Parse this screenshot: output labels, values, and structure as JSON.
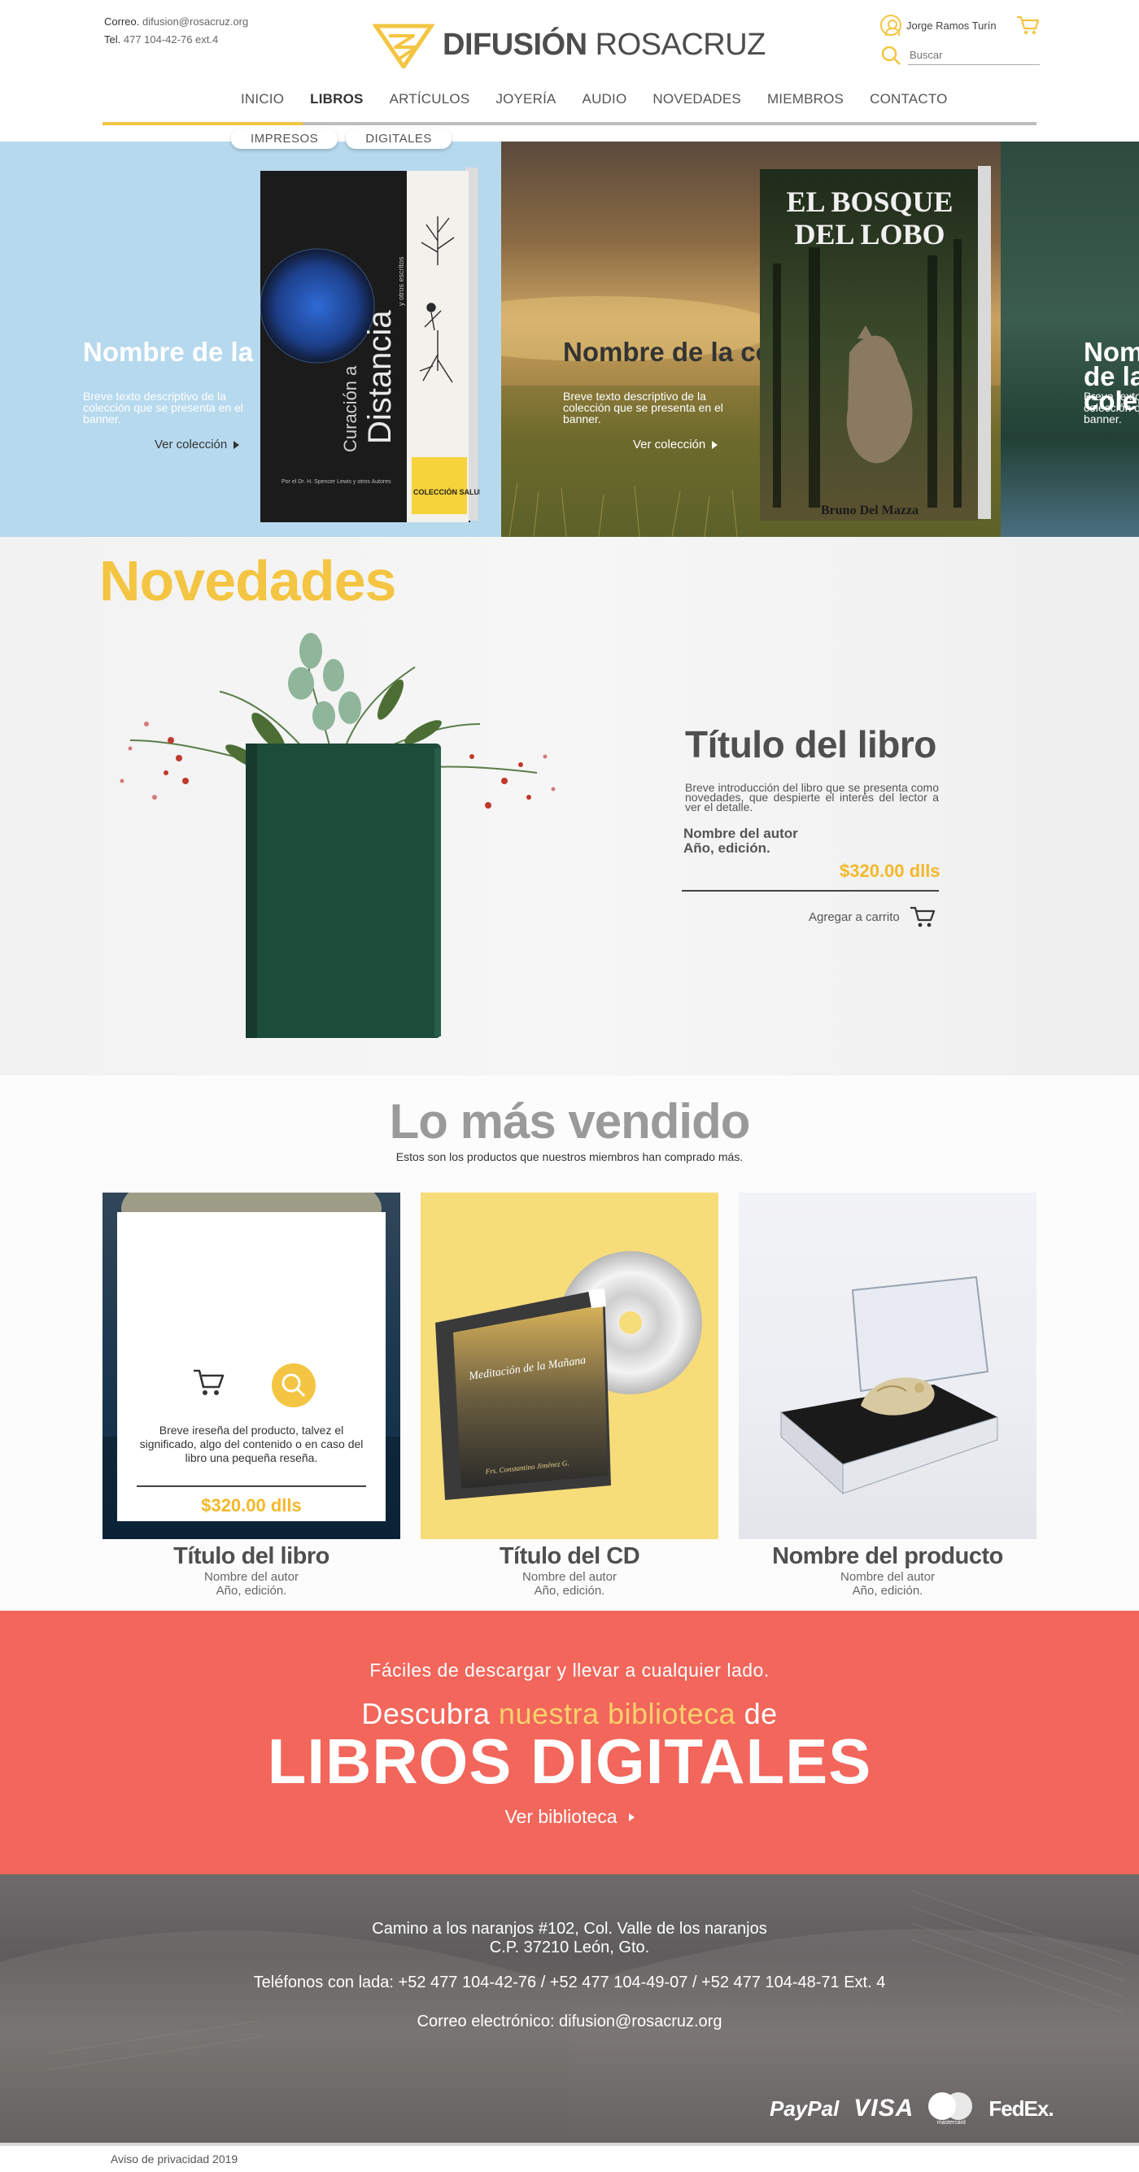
{
  "header": {
    "contact": {
      "email_label": "Correo.",
      "email": "difusion@rosacruz.org",
      "phone_label": "Tel.",
      "phone": "477 104-42-76  ext.4"
    },
    "logo": {
      "bold": "DIFUSIÓN",
      "regular": "ROSACRUZ"
    },
    "user_name": "Jorge Ramos Turín",
    "search_placeholder": "Buscar",
    "nav": [
      "INICIO",
      "LIBROS",
      "ARTÍCULOS",
      "JOYERÍA",
      "AUDIO",
      "NOVEDADES",
      "MIEMBROS",
      "CONTACTO"
    ],
    "active_nav": "LIBROS",
    "subnav": [
      "IMPRESOS",
      "DIGITALES"
    ]
  },
  "banner": {
    "slides": [
      {
        "title": "Nombre de la colección.",
        "desc": "Breve texto descriptivo de la colección que se presenta en el banner.",
        "link": "Ver colección",
        "book": {
          "title_small": "Curación a",
          "title_big": "Distancia",
          "title_sub": "y otros escritos",
          "author": "Por el Dr. H. Spencer Lewis y otros Autores",
          "series": "COLECCIÓN SALUD"
        }
      },
      {
        "title": "Nombre de la colección.",
        "desc": "Breve texto descriptivo de la colección que se presenta en el banner.",
        "link": "Ver colección",
        "book": {
          "title_line1": "EL BOSQUE",
          "title_line2": "DEL LOBO",
          "author": "Bruno Del Mazza"
        }
      },
      {
        "title": "Nombre de la colección.",
        "desc": "Breve texto descriptivo de la colección que se presenta en el banner."
      }
    ]
  },
  "novedades": {
    "heading": "Novedades",
    "book_title": "Título del libro",
    "desc": "Breve introducción del libro que se presenta como novedades, que despierte el interés del lector a ver el detalle.",
    "author": "Nombre del autor",
    "year": "Año, edición.",
    "price": "$320.00 dlls",
    "cart_label": "Agregar a carrito"
  },
  "bestsellers": {
    "heading": "Lo más vendido",
    "subheading": "Estos son los productos que nuestros miembros han comprado más.",
    "items": [
      {
        "title": "Título del libro",
        "author": "Nombre del autor",
        "year": "Año, edición.",
        "overlay_desc": "Breve ireseña del producto, talvez el significado, algo del contenido o en caso del libro una pequeña reseña.",
        "overlay_price": "$320.00 dlls"
      },
      {
        "title": "Título del CD",
        "author": "Nombre del autor",
        "year": "Año, edición.",
        "cd_cover_text": "Meditación de la Mañana",
        "cd_cover_sub": "Frs. Constantino Jiménez G."
      },
      {
        "title": "Nombre del producto",
        "author": "Nombre del autor",
        "year": "Año, edición."
      }
    ]
  },
  "digital": {
    "tagline": "Fáciles de descargar y llevar a cualquier lado.",
    "line_pre": "Descubra",
    "line_highlight": "nuestra biblioteca",
    "line_post": "de",
    "big": "LIBROS DIGITALES",
    "link": "Ver biblioteca"
  },
  "footer": {
    "address1": "Camino a los naranjos #102, Col. Valle de los naranjos",
    "address2": "C.P. 37210 León, Gto.",
    "phones": "Teléfonos con lada: +52 477 104-42-76  /  +52 477 104-49-07  /  +52 477 104-48-71 Ext. 4",
    "email": "Correo electrónico: difusion@rosacruz.org",
    "payments": {
      "paypal": "PayPal",
      "visa": "VISA",
      "mastercard": "mastercard",
      "fedex": "FedEx."
    },
    "privacy": "Aviso de privacidad 2019"
  },
  "colors": {
    "accent_yellow": "#f4c542",
    "price_gold": "#f4b82c",
    "coral": "#f2665b",
    "heading_gray": "#9a9a9a",
    "footer_gray": "#666464"
  }
}
